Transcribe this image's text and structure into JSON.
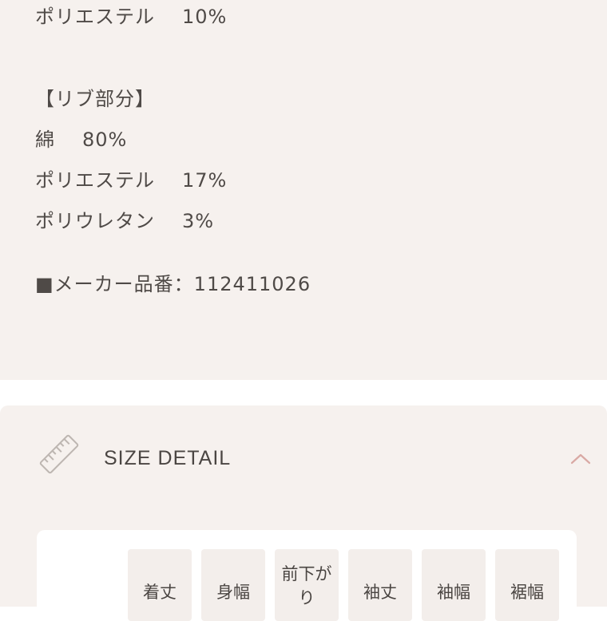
{
  "material": {
    "top_line": {
      "name": "ポリエステル",
      "pct": "10%"
    },
    "rib_heading": "【リブ部分】",
    "rib_items": [
      {
        "name": "綿",
        "pct": "80%"
      },
      {
        "name": "ポリエステル",
        "pct": "17%"
      },
      {
        "name": "ポリウレタン",
        "pct": "3%"
      }
    ],
    "maker_number": "■メーカー品番：112411026"
  },
  "size_detail": {
    "title": "SIZE DETAIL",
    "icon": "ruler-icon",
    "toggle_icon": "chevron-up-icon",
    "columns": [
      "着丈",
      "身幅",
      "前下がり",
      "袖丈",
      "袖幅",
      "裾幅"
    ]
  }
}
